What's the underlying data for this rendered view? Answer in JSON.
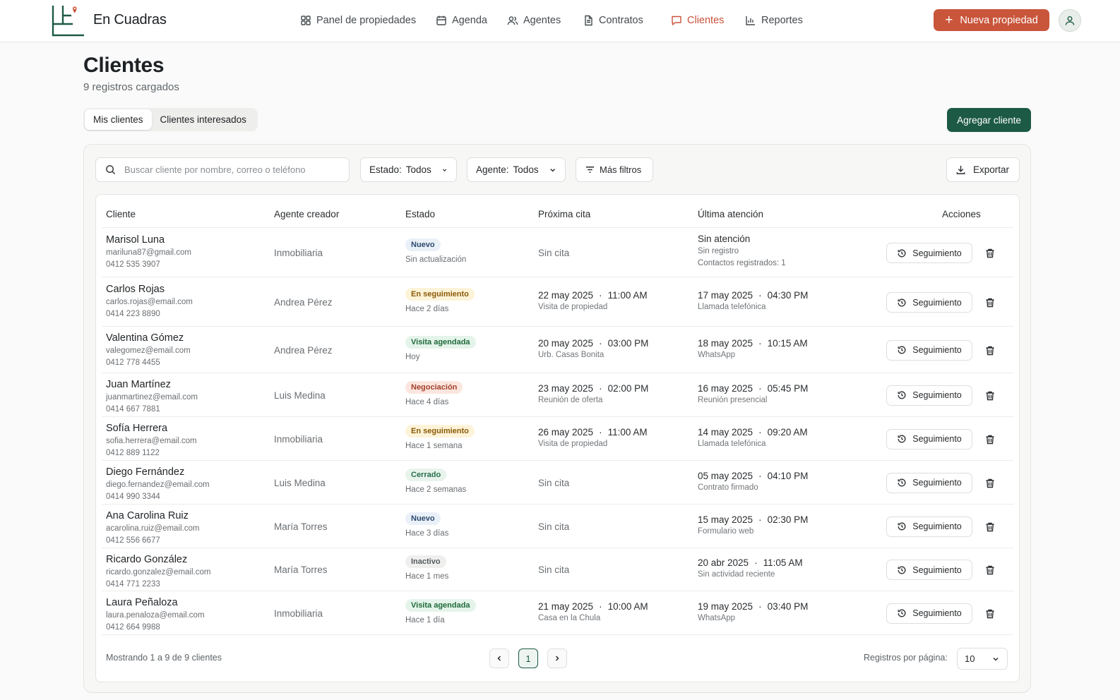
{
  "app": {
    "brand": "En Cuadras"
  },
  "nav": [
    {
      "label": "Panel de propiedades",
      "icon": "grid-icon",
      "active": false
    },
    {
      "label": "Agenda",
      "icon": "calendar-icon",
      "active": false
    },
    {
      "label": "Agentes",
      "icon": "users-icon",
      "active": false
    },
    {
      "label": "Contratos",
      "icon": "document-icon",
      "active": false
    },
    {
      "label": "Clientes",
      "icon": "chat-icon",
      "active": true
    },
    {
      "label": "Reportes",
      "icon": "bar-chart-icon",
      "active": false
    }
  ],
  "header": {
    "new_property": "Nueva propiedad"
  },
  "page": {
    "title": "Clientes",
    "subtitle": "9 registros cargados",
    "add_client": "Agregar cliente"
  },
  "tabs": [
    {
      "label": "Mis clientes",
      "selected": true
    },
    {
      "label": "Clientes interesados",
      "selected": false
    }
  ],
  "filters": {
    "search_placeholder": "Buscar cliente por nombre, correo o teléfono",
    "estado_label": "Estado:",
    "estado_value": "Todos",
    "agente_label": "Agente:",
    "agente_value": "Todos",
    "more_filters": "Más filtros",
    "export": "Exportar"
  },
  "table": {
    "columns": [
      "Cliente",
      "Agente creador",
      "Estado",
      "Próxima cita",
      "Última atención",
      "Acciones"
    ],
    "action_label": "Seguimiento",
    "rows": [
      {
        "name": "Marisol Luna",
        "email": "mariluna87@gmail.com",
        "phone": "0412 535 3907",
        "agent": "Inmobiliaria",
        "status": "Nuevo",
        "status_kind": "nuevo",
        "status_sub": "Sin actualización",
        "next": "Sin cita",
        "next_time": "",
        "next_sub": "",
        "last": "Sin atención",
        "last_time": "",
        "last_sub": "Sin registro",
        "last_extra": "Contactos registrados: 1"
      },
      {
        "name": "Carlos Rojas",
        "email": "carlos.rojas@email.com",
        "phone": "0414 223 8890",
        "agent": "Andrea Pérez",
        "status": "En seguimiento",
        "status_kind": "seguimiento",
        "status_sub": "Hace 2 días",
        "next": "22 may 2025",
        "next_time": "11:00 AM",
        "next_sub": "Visita de propiedad",
        "last": "17 may 2025",
        "last_time": "04:30 PM",
        "last_sub": "Llamada telefónica",
        "last_extra": ""
      },
      {
        "name": "Valentina Gómez",
        "email": "valegomez@email.com",
        "phone": "0412 778 4455",
        "agent": "Andrea Pérez",
        "status": "Visita agendada",
        "status_kind": "visita",
        "status_sub": "Hoy",
        "next": "20 may 2025",
        "next_time": "03:00 PM",
        "next_sub": "Urb. Casas Bonita",
        "last": "18 may 2025",
        "last_time": "10:15 AM",
        "last_sub": "WhatsApp",
        "last_extra": ""
      },
      {
        "name": "Juan Martínez",
        "email": "juanmartinez@email.com",
        "phone": "0414 667 7881",
        "agent": "Luis Medina",
        "status": "Negociación",
        "status_kind": "negociacion",
        "status_sub": "Hace 4 días",
        "next": "23 may 2025",
        "next_time": "02:00 PM",
        "next_sub": "Reunión de oferta",
        "last": "16 may 2025",
        "last_time": "05:45 PM",
        "last_sub": "Reunión presencial",
        "last_extra": ""
      },
      {
        "name": "Sofía Herrera",
        "email": "sofia.herrera@email.com",
        "phone": "0412 889 1122",
        "agent": "Inmobiliaria",
        "status": "En seguimiento",
        "status_kind": "seguimiento",
        "status_sub": "Hace 1 semana",
        "next": "26 may 2025",
        "next_time": "11:00 AM",
        "next_sub": "Visita de propiedad",
        "last": "14 may 2025",
        "last_time": "09:20 AM",
        "last_sub": "Llamada telefónica",
        "last_extra": ""
      },
      {
        "name": "Diego Fernández",
        "email": "diego.fernandez@email.com",
        "phone": "0414 990 3344",
        "agent": "Luis Medina",
        "status": "Cerrado",
        "status_kind": "cerrado",
        "status_sub": "Hace 2 semanas",
        "next": "Sin cita",
        "next_time": "",
        "next_sub": "",
        "last": "05 may 2025",
        "last_time": "04:10 PM",
        "last_sub": "Contrato firmado",
        "last_extra": ""
      },
      {
        "name": "Ana Carolina Ruiz",
        "email": "acarolina.ruiz@email.com",
        "phone": "0412 556 6677",
        "agent": "María Torres",
        "status": "Nuevo",
        "status_kind": "nuevo",
        "status_sub": "Hace 3 días",
        "next": "Sin cita",
        "next_time": "",
        "next_sub": "",
        "last": "15 may 2025",
        "last_time": "02:30 PM",
        "last_sub": "Formulario web",
        "last_extra": ""
      },
      {
        "name": "Ricardo González",
        "email": "ricardo.gonzalez@email.com",
        "phone": "0414 771 2233",
        "agent": "María Torres",
        "status": "Inactivo",
        "status_kind": "inactivo",
        "status_sub": "Hace 1 mes",
        "next": "Sin cita",
        "next_time": "",
        "next_sub": "",
        "last": "20 abr 2025",
        "last_time": "11:05 AM",
        "last_sub": "Sin actividad reciente",
        "last_extra": ""
      },
      {
        "name": "Laura Peñaloza",
        "email": "laura.penaloza@email.com",
        "phone": "0412 664 9988",
        "agent": "Inmobiliaria",
        "status": "Visita agendada",
        "status_kind": "visita",
        "status_sub": "Hace 1 día",
        "next": "21 may 2025",
        "next_time": "10:00 AM",
        "next_sub": "Casa en la Chula",
        "last": "19 may 2025",
        "last_time": "03:40 PM",
        "last_sub": "WhatsApp",
        "last_extra": ""
      }
    ]
  },
  "footer": {
    "showing": "Mostrando 1 a 9 de 9 clientes",
    "page": "1",
    "per_page_label": "Registros por página:",
    "per_page_value": "10"
  },
  "colors": {
    "accent": "#c9553b",
    "primary": "#1d5a45"
  },
  "status_colors": {
    "nuevo": {
      "bg": "#eaf0f8",
      "fg": "#2c4a6e"
    },
    "seguimiento": {
      "bg": "#fdf3d8",
      "fg": "#8a5a06"
    },
    "visita": {
      "bg": "#e5f4ea",
      "fg": "#1e6a3a"
    },
    "negociacion": {
      "bg": "#fbe6df",
      "fg": "#a3402a"
    },
    "cerrado": {
      "bg": "#e8f3ec",
      "fg": "#26704a"
    },
    "inactivo": {
      "bg": "#efefee",
      "fg": "#555a5e"
    }
  }
}
